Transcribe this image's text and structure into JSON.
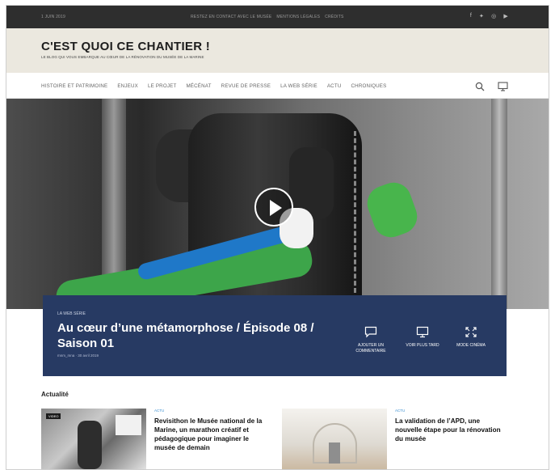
{
  "topbar": {
    "date": "1 JUIN 2019",
    "links": [
      "RESTEZ EN CONTACT AVEC LE MUSÉE",
      "MENTIONS LÉGALES",
      "CRÉDITS"
    ],
    "social_icons": [
      "facebook-icon",
      "twitter-icon",
      "instagram-icon",
      "youtube-icon"
    ]
  },
  "header": {
    "title": "C'EST QUOI CE CHANTIER !",
    "tagline": "LE BLOG QUI VOUS EMBARQUE AU CŒUR DE LA RÉNOVATION DU MUSÉE DE LA MARINE"
  },
  "nav": {
    "items": [
      "HISTOIRE ET PATRIMOINE",
      "ENJEUX",
      "LE PROJET",
      "MÉCÉNAT",
      "REVUE DE PRESSE",
      "LA WEB SÉRIE",
      "ACTU",
      "CHRONIQUES"
    ],
    "icons": [
      "search-icon",
      "monitor-icon"
    ]
  },
  "hero": {
    "category": "LA WEB SÉRIE",
    "headline": "Au cœur d’une métamorphose / Épisode 08 / Saison 01",
    "meta": "mnm_mna · 30 avril 2019",
    "actions": [
      {
        "label": "AJOUTER UN COMMENTAIRE",
        "icon": "comment-icon"
      },
      {
        "label": "VOIR PLUS TARD",
        "icon": "monitor-icon"
      },
      {
        "label": "MODE CINÉMA",
        "icon": "expand-icon"
      }
    ]
  },
  "news": {
    "section_title": "Actualité",
    "cards": [
      {
        "tag": "ACTU",
        "badge": "VIDEO",
        "title": "Revisithon le Musée national de la Marine, un marathon créatif et pédagogique pour imaginer le musée de demain"
      },
      {
        "tag": "ACTU",
        "title": "La validation de l’APD, une nouvelle étape pour la rénovation du musée"
      }
    ]
  }
}
